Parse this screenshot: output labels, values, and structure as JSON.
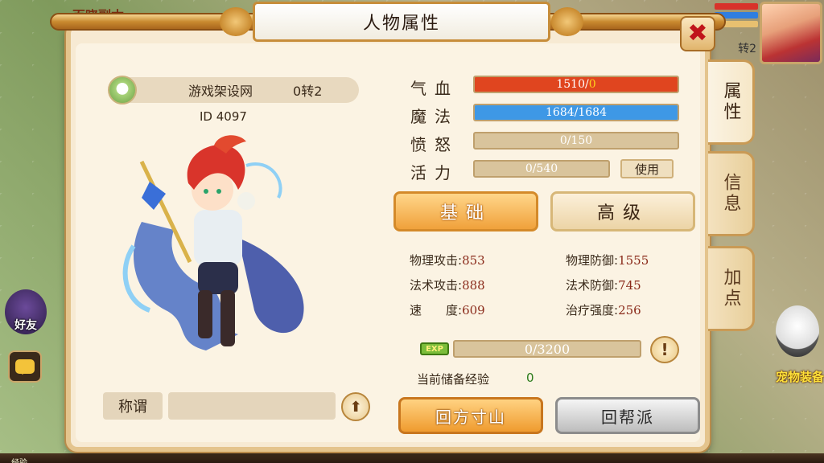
{
  "window": {
    "title": "人物属性",
    "close_icon": "close-icon"
  },
  "side_tabs": [
    {
      "label": "属性",
      "active": true
    },
    {
      "label": "信息",
      "active": false
    },
    {
      "label": "加点",
      "active": false
    }
  ],
  "hud": {
    "top_left_label": "百晓副本",
    "friend_label": "好友",
    "rank_tag": "转2",
    "pet_label": "宠物装备",
    "bottom_label": "经验"
  },
  "character": {
    "name": "游戏架设网",
    "rank": "0转2",
    "id_label": "ID 4097"
  },
  "vitals": {
    "hp": {
      "label": "气血",
      "current": "1510",
      "sep": "/",
      "max": "0",
      "fill": 1.0
    },
    "mp": {
      "label": "魔法",
      "text": "1684/1684",
      "fill": 1.0
    },
    "rage": {
      "label": "愤怒",
      "text": "0/150",
      "fill": 0.0
    },
    "vigor": {
      "label": "活力",
      "text": "0/540",
      "fill": 0.0,
      "use_label": "使用"
    }
  },
  "tabs": {
    "basic": "基础",
    "advanced": "高级"
  },
  "attributes": {
    "phys_atk": {
      "label": "物理攻击:",
      "value": "853"
    },
    "phys_def": {
      "label": "物理防御:",
      "value": "1555"
    },
    "mag_atk": {
      "label": "法术攻击:",
      "value": "888"
    },
    "mag_def": {
      "label": "法术防御:",
      "value": "745"
    },
    "speed": {
      "label": "速　　度:",
      "value": "609"
    },
    "heal": {
      "label": "治疗强度:",
      "value": "256"
    }
  },
  "exp": {
    "badge": "EXP",
    "text": "0/3200",
    "fill": 0.0,
    "stored_label": "当前储备经验",
    "stored_value": "0"
  },
  "title_field": {
    "label": "称谓",
    "value": ""
  },
  "actions": {
    "return_school": "回方寸山",
    "return_guild": "回帮派"
  },
  "colors": {
    "hp": "#e0451f",
    "mp": "#3e98e6",
    "accent": "#f0a13b"
  }
}
